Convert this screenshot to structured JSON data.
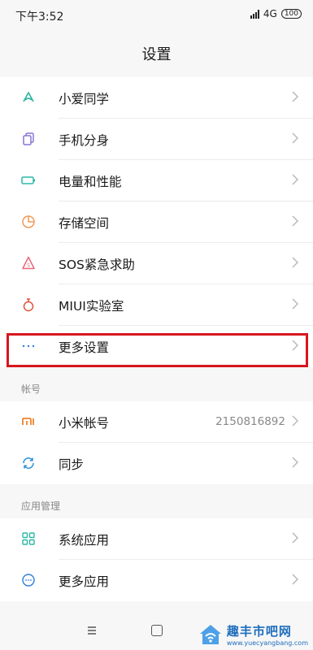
{
  "status": {
    "time": "下午3:52",
    "network": "4G",
    "battery": "100"
  },
  "header": {
    "title": "设置"
  },
  "groups": [
    {
      "items": [
        {
          "label": "小爱同学",
          "icon": "xiaoai-icon"
        },
        {
          "label": "手机分身",
          "icon": "phone-clone-icon"
        },
        {
          "label": "电量和性能",
          "icon": "battery-icon"
        },
        {
          "label": "存储空间",
          "icon": "storage-icon"
        },
        {
          "label": "SOS紧急求助",
          "icon": "sos-icon"
        },
        {
          "label": "MIUI实验室",
          "icon": "lab-flask-icon"
        },
        {
          "label": "更多设置",
          "icon": "more-dots-icon"
        }
      ]
    },
    {
      "section": "帐号",
      "items": [
        {
          "label": "小米帐号",
          "value": "2150816892",
          "icon": "mi-logo-icon"
        },
        {
          "label": "同步",
          "icon": "sync-icon"
        }
      ]
    },
    {
      "section": "应用管理",
      "items": [
        {
          "label": "系统应用",
          "icon": "apps-grid-icon"
        },
        {
          "label": "更多应用",
          "icon": "more-apps-icon"
        }
      ]
    }
  ],
  "watermark": {
    "name": "趣丰市吧网",
    "url": "www.yuecyangbang.com"
  },
  "colors": {
    "highlight": "#d7161e",
    "accent": "#2b7fd8"
  }
}
